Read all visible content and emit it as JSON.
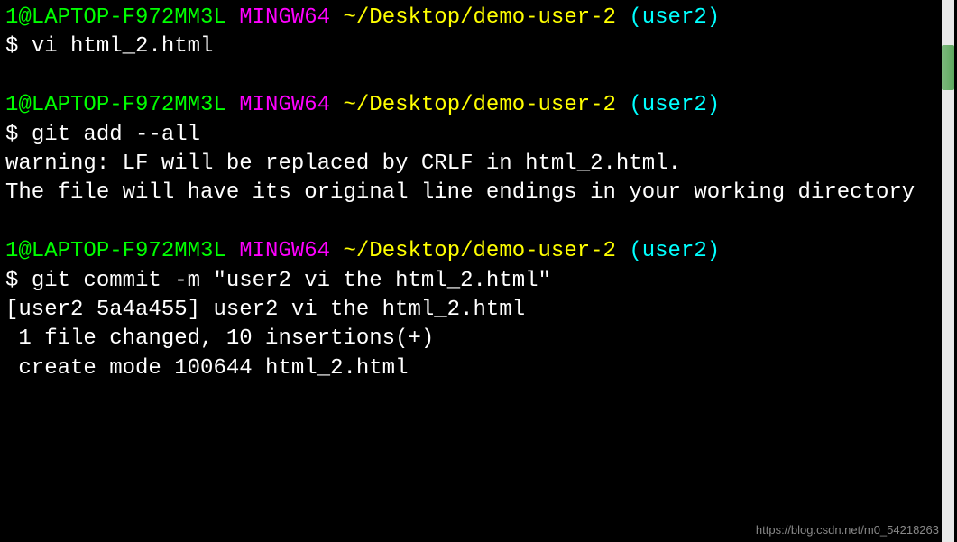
{
  "prompt": {
    "user_host": "1@LAPTOP-F972MM3L",
    "env": "MINGW64",
    "path": "~/Desktop/demo-user-2",
    "branch_open": "(",
    "branch_name": "user2",
    "branch_close": ")",
    "symbol": "$ "
  },
  "commands": {
    "cmd1": "vi html_2.html",
    "cmd2": "git add --all",
    "cmd3": "git commit -m \"user2 vi the html_2.html\""
  },
  "output": {
    "warning_line1": "warning: LF will be replaced by CRLF in html_2.html.",
    "warning_line2": "The file will have its original line endings in your working directory",
    "commit_line1": "[user2 5a4a455] user2 vi the html_2.html",
    "commit_line2": " 1 file changed, 10 insertions(+)",
    "commit_line3": " create mode 100644 html_2.html"
  },
  "watermark": "https://blog.csdn.net/m0_54218263"
}
